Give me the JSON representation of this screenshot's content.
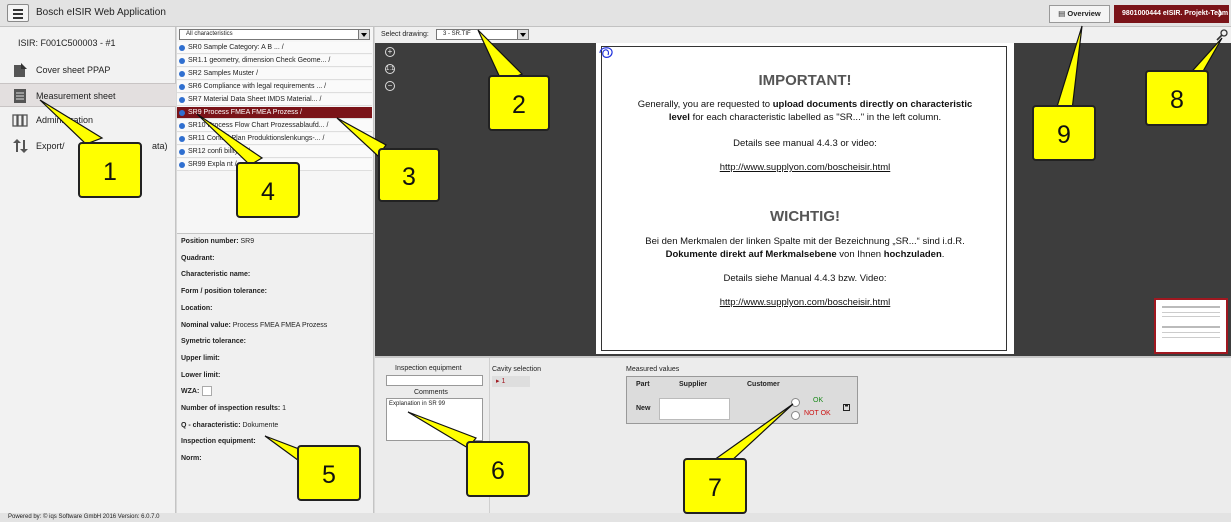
{
  "app": {
    "title": "Bosch  eISIR Web Application",
    "overview": "Overview",
    "user": "9801000444 eISIR. Projekt-Team"
  },
  "nav": {
    "isir_id": "ISIR: F001C500003 - #1",
    "items": [
      {
        "label": "Cover sheet PPAP",
        "icon": "cover-sheet-icon"
      },
      {
        "label": "Measurement sheet",
        "icon": "measurement-sheet-icon"
      },
      {
        "label": "Administration",
        "icon": "administration-icon"
      },
      {
        "label": "Export/",
        "label_tail": "ata)",
        "icon": "export-icon"
      }
    ]
  },
  "characteristics": {
    "filter": "All characteristics",
    "items": [
      "SR0 Sample Category: A B ... /",
      "SR1.1 geometry, dimension Check Geome... /",
      "SR2 Samples Muster /",
      "SR6 Compliance with legal requirements ... /",
      "SR7 Material Data Sheet IMDS Material... /",
      "SR9 Process FMEA FMEA Prozess /",
      "SR10 Process Flow Chart Prozessablaufd... /",
      "SR11 Control Plan Produktionslenkungs-... /",
      "SR12 confi                         bility ... /",
      "SR99 Expla                          nt /"
    ],
    "selected_index": 5
  },
  "details": {
    "position_number_label": "Position number:",
    "position_number": "SR9",
    "quadrant_label": "Quadrant:",
    "characteristic_name_label": "Characteristic name:",
    "form_tolerance_label": "Form / position tolerance:",
    "location_label": "Location:",
    "nominal_value_label": "Nominal value:",
    "nominal_value": "Process FMEA  FMEA Prozess",
    "symetric_tolerance_label": "Symetric tolerance:",
    "upper_limit_label": "Upper limit:",
    "lower_limit_label": "Lower limit:",
    "wza_label": "WZA:",
    "inspection_results_label": "Number of inspection results:",
    "inspection_results": "1",
    "q_characteristic_label": "Q - characteristic:",
    "q_characteristic": "Dokumente",
    "inspection_equipment_label": "Inspection equipment:",
    "norm_label": "Norm:"
  },
  "drawing": {
    "select_label": "Select drawing:",
    "selected": "3 - SR.TIF",
    "document": {
      "heading_en": "IMPORTANT!",
      "en_line1_pre": "Generally, you are requested to ",
      "en_line1_bold": "upload documents directly on characteristic",
      "en_line2_bold": "level",
      "en_line2_post": " for each characteristic labelled as \"SR...\" in the left column.",
      "en_details": "Details see manual 4.4.3 or video:",
      "link": "http://www.supplyon.com/boscheisir.html",
      "heading_de": "WICHTIG!",
      "de_line1": "Bei den Merkmalen der linken Spalte mit der Bezeichnung „SR...“ sind i.d.R.",
      "de_line2_bold1": "Dokumente direkt auf Merkmalsebene",
      "de_line2_mid": " von Ihnen ",
      "de_line2_bold2": "hochzuladen",
      "de_line2_end": ".",
      "de_details": "Details siehe Manual 4.4.3 bzw. Video:"
    }
  },
  "bottom": {
    "inspection_equipment": "Inspection equipment",
    "comments": "Comments",
    "comment_text": "Explanation in SR 99",
    "cavity_selection": "Cavity selection",
    "cavity_value": "1",
    "measured_values": "Measured values",
    "col_part": "Part",
    "col_supplier": "Supplier",
    "col_customer": "Customer",
    "row_new": "New",
    "ok": "OK",
    "not_ok": "NOT OK"
  },
  "footer": "Powered by: © iqs Software GmbH 2016 Version: 6.0.7.0",
  "callouts": [
    "1",
    "2",
    "3",
    "4",
    "5",
    "6",
    "7",
    "8",
    "9"
  ],
  "colors": {
    "accent": "#7a1318",
    "callout": "#ffff00",
    "link_dot": "#2f6fd0"
  }
}
